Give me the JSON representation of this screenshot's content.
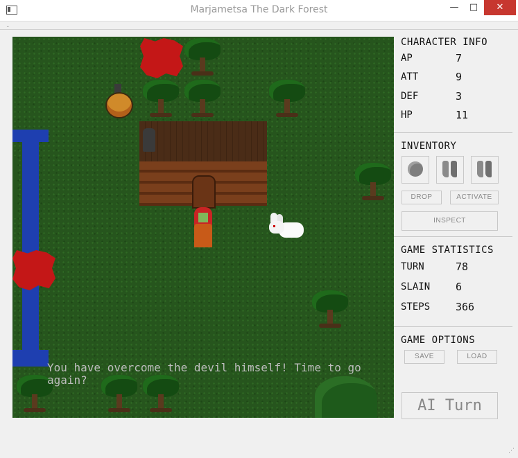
{
  "window": {
    "title": "Marjametsa The Dark Forest",
    "minimize": "—",
    "maximize": "□",
    "close": "✕"
  },
  "menu": {
    "dot": "."
  },
  "game": {
    "message": "You have overcome the devil himself! Time to go again?",
    "icons": [
      "blood-splatter-icon",
      "tree-icon",
      "potion-icon",
      "house-icon",
      "player-character-icon",
      "rabbit-icon",
      "bush-icon",
      "river-icon"
    ]
  },
  "character_info": {
    "title": "CHARACTER INFO",
    "stats": [
      {
        "label": "AP",
        "value": "7"
      },
      {
        "label": "ATT",
        "value": "9"
      },
      {
        "label": "DEF",
        "value": "3"
      },
      {
        "label": "HP",
        "value": "11"
      }
    ]
  },
  "inventory": {
    "title": "INVENTORY",
    "slots": [
      "stone-icon",
      "boots-icon",
      "boots-icon"
    ],
    "drop": "DROP",
    "activate": "ACTIVATE",
    "inspect": "INSPECT"
  },
  "game_statistics": {
    "title": "GAME STATISTICS",
    "stats": [
      {
        "label": "TURN",
        "value": "78"
      },
      {
        "label": "SLAIN",
        "value": "6"
      },
      {
        "label": "STEPS",
        "value": "366"
      }
    ]
  },
  "game_options": {
    "title": "GAME OPTIONS",
    "save": "SAVE",
    "load": "LOAD"
  },
  "ai_turn": "AI Turn",
  "colors": {
    "grass": "#26551d",
    "blood": "#c41717",
    "river": "#1e3fb0",
    "close_button": "#c7372f"
  }
}
